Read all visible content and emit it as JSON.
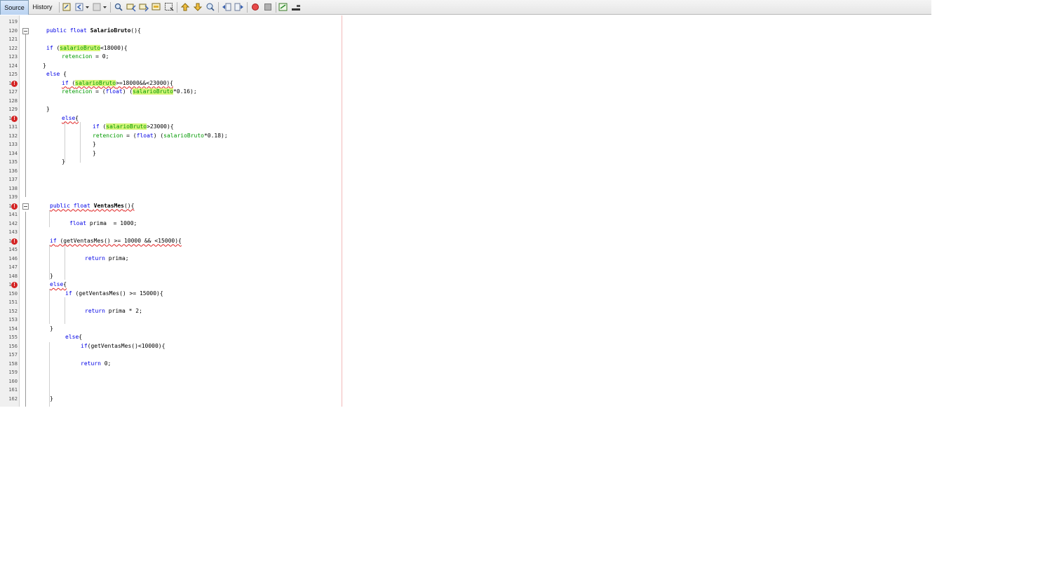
{
  "tabs": {
    "source": "Source",
    "history": "History"
  },
  "toolbar_icons": [
    "last-edit-icon",
    "back-icon",
    "forward-icon",
    "find-selection-icon",
    "find-previous-icon",
    "find-next-icon",
    "toggle-highlight-icon",
    "toggle-rectangular-selection-icon",
    "previous-bookmark-icon",
    "next-bookmark-icon",
    "toggle-bookmark-icon",
    "shift-left-icon",
    "shift-right-icon",
    "start-macro-icon",
    "stop-macro-icon",
    "comment-icon",
    "uncomment-icon"
  ],
  "colors": {
    "keyword": "#0000e6",
    "field": "#009900",
    "highlight": "#d6f57a",
    "error": "#d42424",
    "margin": "#f2b9b9"
  },
  "lines": [
    {
      "n": "119",
      "code": ""
    },
    {
      "n": "120",
      "code": "public float SalarioBruto(){"
    },
    {
      "n": "121",
      "code": ""
    },
    {
      "n": "122",
      "code": "if (salarioBruto<18000){"
    },
    {
      "n": "123",
      "code": "retencion = 0;"
    },
    {
      "n": "124",
      "code": "}"
    },
    {
      "n": "125",
      "code": "else {"
    },
    {
      "n": "126",
      "code": "if (salarioBruto>=18000&&<23000){"
    },
    {
      "n": "127",
      "code": "retencion = (float) (salarioBruto*0.16);"
    },
    {
      "n": "128",
      "code": ""
    },
    {
      "n": "129",
      "code": "}"
    },
    {
      "n": "130",
      "code": "else{"
    },
    {
      "n": "131",
      "code": "if (salarioBruto>23000){"
    },
    {
      "n": "132",
      "code": "retencion = (float) (salarioBruto*0.18);"
    },
    {
      "n": "133",
      "code": "}"
    },
    {
      "n": "134",
      "code": "}"
    },
    {
      "n": "135",
      "code": "}"
    },
    {
      "n": "136",
      "code": ""
    },
    {
      "n": "137",
      "code": ""
    },
    {
      "n": "138",
      "code": ""
    },
    {
      "n": "139",
      "code": ""
    },
    {
      "n": "140",
      "code": "public float VentasMes(){"
    },
    {
      "n": "141",
      "code": ""
    },
    {
      "n": "142",
      "code": "float prima  = 1000;"
    },
    {
      "n": "143",
      "code": ""
    },
    {
      "n": "144",
      "code": "if (getVentasMes() >= 10000 && <15000){"
    },
    {
      "n": "145",
      "code": ""
    },
    {
      "n": "146",
      "code": "return prima;"
    },
    {
      "n": "147",
      "code": ""
    },
    {
      "n": "148",
      "code": "}"
    },
    {
      "n": "149",
      "code": "else{"
    },
    {
      "n": "150",
      "code": "if (getVentasMes() >= 15000){"
    },
    {
      "n": "151",
      "code": ""
    },
    {
      "n": "152",
      "code": "return prima * 2;"
    },
    {
      "n": "153",
      "code": ""
    },
    {
      "n": "154",
      "code": "}"
    },
    {
      "n": "155",
      "code": "else{"
    },
    {
      "n": "156",
      "code": "if(getVentasMes()<10000){"
    },
    {
      "n": "157",
      "code": ""
    },
    {
      "n": "158",
      "code": "return 0;"
    },
    {
      "n": "159",
      "code": ""
    },
    {
      "n": "160",
      "code": ""
    },
    {
      "n": "161",
      "code": ""
    },
    {
      "n": "162",
      "code": "}"
    }
  ]
}
